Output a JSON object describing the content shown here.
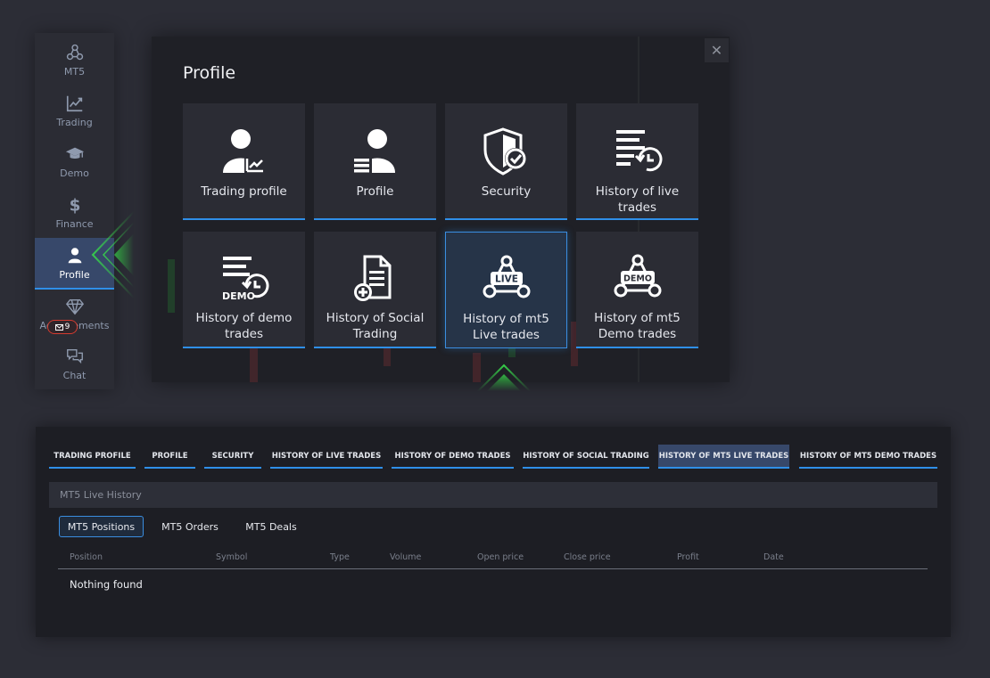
{
  "sidebar": {
    "items": [
      {
        "label": "MT5",
        "icon": "mt5-network-icon"
      },
      {
        "label": "Trading",
        "icon": "trading-chart-icon"
      },
      {
        "label": "Demo",
        "icon": "graduation-cap-icon"
      },
      {
        "label": "Finance",
        "icon": "dollar-icon"
      },
      {
        "label": "Profile",
        "icon": "user-icon"
      },
      {
        "label": "Achievements",
        "icon": "diamond-icon"
      },
      {
        "label": "Chat",
        "icon": "chat-bubbles-icon"
      }
    ],
    "chat_badge": "9"
  },
  "modal": {
    "title": "Profile",
    "close": "✕",
    "tiles": [
      {
        "label": "Trading profile",
        "icon": "trading-profile-icon"
      },
      {
        "label": "Profile",
        "icon": "profile-icon"
      },
      {
        "label": "Security",
        "icon": "shield-check-icon"
      },
      {
        "label": "History of live trades",
        "icon": "live-history-icon"
      },
      {
        "label": "History of demo trades",
        "icon": "demo-history-icon"
      },
      {
        "label": "History of Social Trading",
        "icon": "social-document-icon"
      },
      {
        "label": "History of mt5 Live trades",
        "icon": "mt5-live-icon",
        "badge": "LIVE"
      },
      {
        "label": "History of mt5 Demo trades",
        "icon": "mt5-demo-icon",
        "badge": "DEMO"
      }
    ],
    "demo_icon_text": "DEMO"
  },
  "panel": {
    "tabs": [
      "TRADING PROFILE",
      "PROFILE",
      "SECURITY",
      "HISTORY OF LIVE TRADES",
      "HISTORY OF DEMO TRADES",
      "HISTORY OF SOCIAL TRADING",
      "HISTORY OF MT5 LIVE TRADES",
      "HISTORY OF MT5 DEMO TRADES"
    ],
    "section_title": "MT5 Live History",
    "sub_tabs": [
      "MT5 Positions",
      "MT5 Orders",
      "MT5 Deals"
    ],
    "columns": [
      "Position",
      "Symbol",
      "Type",
      "Volume",
      "Open price",
      "Close price",
      "Profit",
      "Date"
    ],
    "empty_text": "Nothing found"
  },
  "colors": {
    "accent": "#2f8fe8",
    "active_bg": "#37486a",
    "pointer_green": "#2ecc40",
    "badge_red": "#d33b2f"
  }
}
